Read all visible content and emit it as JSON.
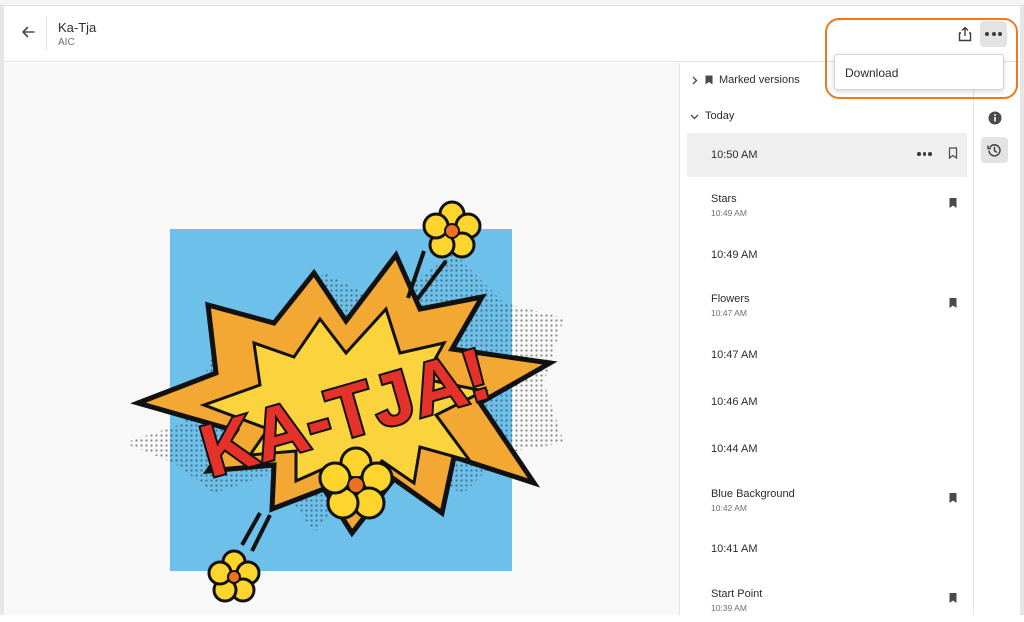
{
  "header": {
    "title": "Ka-Tja",
    "subtitle": "AIC"
  },
  "menu": {
    "download_label": "Download"
  },
  "artwork": {
    "text": "KA-TJA!",
    "colors": {
      "background": "#6cc0ea",
      "burst_outer": "#f2a833",
      "burst_inner": "#fbd33c",
      "letters": "#e4322a",
      "flower_petal": "#fdd52c",
      "flower_center": "#f07023"
    }
  },
  "panel": {
    "marked_versions_label": "Marked versions",
    "today_label": "Today",
    "versions": [
      {
        "name": "",
        "time": "10:50 AM",
        "marked": false,
        "selected": true
      },
      {
        "name": "Stars",
        "time": "10:49 AM",
        "marked": true,
        "selected": false
      },
      {
        "name": "",
        "time": "10:49 AM",
        "marked": false,
        "selected": false
      },
      {
        "name": "Flowers",
        "time": "10:47 AM",
        "marked": true,
        "selected": false
      },
      {
        "name": "",
        "time": "10:47 AM",
        "marked": false,
        "selected": false
      },
      {
        "name": "",
        "time": "10:46 AM",
        "marked": false,
        "selected": false
      },
      {
        "name": "",
        "time": "10:44 AM",
        "marked": false,
        "selected": false
      },
      {
        "name": "Blue Background",
        "time": "10:42 AM",
        "marked": true,
        "selected": false
      },
      {
        "name": "",
        "time": "10:41 AM",
        "marked": false,
        "selected": false
      },
      {
        "name": "Start Point",
        "time": "10:39 AM",
        "marked": true,
        "selected": false
      }
    ]
  },
  "icons": {
    "back": "arrow-left-icon",
    "share": "share-icon",
    "more": "more-icon",
    "info": "info-icon",
    "history": "history-icon",
    "bookmark": "bookmark-icon"
  },
  "accent": {
    "highlight": "#ef7a1e"
  }
}
